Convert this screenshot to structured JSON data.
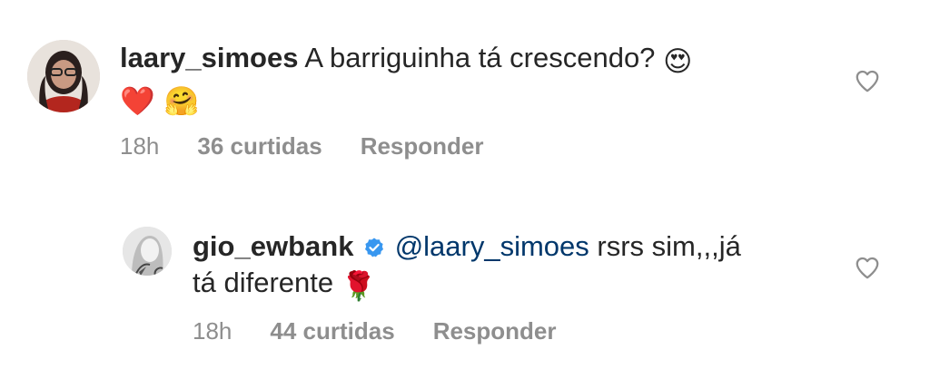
{
  "comments": [
    {
      "username": "laary_simoes",
      "text": "A barriguinha tá crescendo?",
      "emojis_inline": "😍",
      "emojis_line2": "❤️ 🤗",
      "time": "18h",
      "likes": "36 curtidas",
      "reply_label": "Responder",
      "verified": false
    },
    {
      "username": "gio_ewbank",
      "mention": "@laary_simoes",
      "text_line1": "rsrs sim,,,já",
      "text_line2": "tá diferente",
      "emoji": "🌹",
      "time": "18h",
      "likes": "44 curtidas",
      "reply_label": "Responder",
      "verified": true
    }
  ],
  "colors": {
    "text": "#262626",
    "meta": "#8e8e8e",
    "mention": "#00376b",
    "verified": "#3897f0"
  },
  "icons": {
    "like": "heart-outline-icon",
    "verified": "verified-badge-icon"
  }
}
